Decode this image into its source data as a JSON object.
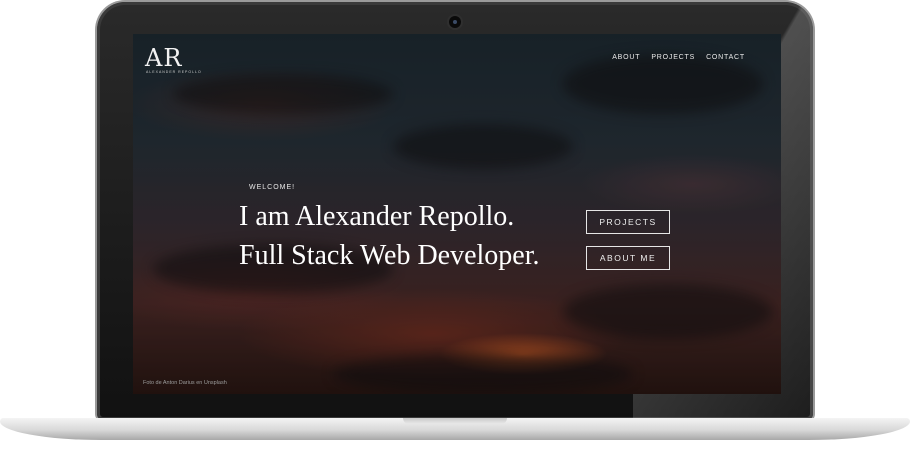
{
  "brand": {
    "logo": "AR",
    "tagline": "ALEXANDER REPOLLO"
  },
  "nav": {
    "items": [
      {
        "label": "ABOUT"
      },
      {
        "label": "PROJECTS"
      },
      {
        "label": "CONTACT"
      }
    ]
  },
  "hero": {
    "welcome": "WELCOME!",
    "line1": "I am Alexander Repollo.",
    "line2": "Full Stack Web Developer."
  },
  "buttons": {
    "projects": "PROJECTS",
    "about": "ABOUT ME"
  },
  "footer": {
    "photo_credit": "Foto de Anton Darius en Unsplash"
  }
}
